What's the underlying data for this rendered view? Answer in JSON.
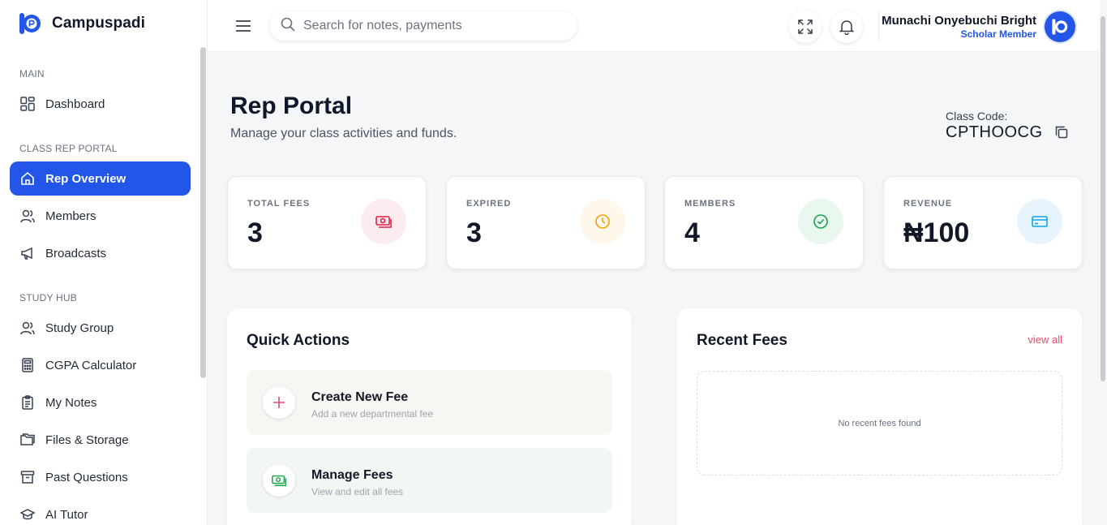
{
  "app": {
    "name": "Campuspadi"
  },
  "sidebar": {
    "sections": [
      {
        "label": "MAIN"
      },
      {
        "label": "CLASS REP PORTAL"
      },
      {
        "label": "STUDY HUB"
      }
    ],
    "items": [
      {
        "label": "Dashboard",
        "icon": "grid-icon"
      },
      {
        "label": "Rep Overview",
        "icon": "home-icon",
        "active": true
      },
      {
        "label": "Members",
        "icon": "users-icon"
      },
      {
        "label": "Broadcasts",
        "icon": "megaphone-icon"
      },
      {
        "label": "Study Group",
        "icon": "users-icon"
      },
      {
        "label": "CGPA Calculator",
        "icon": "calculator-icon"
      },
      {
        "label": "My Notes",
        "icon": "notes-icon"
      },
      {
        "label": "Files & Storage",
        "icon": "folder-icon"
      },
      {
        "label": "Past Questions",
        "icon": "archive-icon"
      },
      {
        "label": "AI Tutor",
        "icon": "graduation-cap-icon"
      }
    ]
  },
  "topbar": {
    "search_placeholder": "Search for notes, payments",
    "user": {
      "name": "Munachi Onyebuchi Bright",
      "role": "Scholar Member"
    }
  },
  "page": {
    "title": "Rep Portal",
    "subtitle": "Manage your class activities and funds.",
    "class_code_label": "Class Code:",
    "class_code": "CPTHOOCG"
  },
  "stats": [
    {
      "label": "TOTAL FEES",
      "value": "3",
      "icon": "cash-icon",
      "color": "#e11d48",
      "bg": "#fdecef"
    },
    {
      "label": "EXPIRED",
      "value": "3",
      "icon": "clock-icon",
      "color": "#f59e0b",
      "bg": "#fef8ea"
    },
    {
      "label": "MEMBERS",
      "value": "4",
      "icon": "check-circle-icon",
      "color": "#16a34a",
      "bg": "#eaf7ee"
    },
    {
      "label": "REVENUE",
      "value": "₦100",
      "icon": "credit-card-icon",
      "color": "#0ea5e9",
      "bg": "#e8f4fd"
    }
  ],
  "quick_actions": {
    "title": "Quick Actions",
    "items": [
      {
        "title": "Create New Fee",
        "subtitle": "Add a new departmental fee",
        "icon": "plus-icon",
        "bg": "#f7f6f2"
      },
      {
        "title": "Manage Fees",
        "subtitle": "View and edit all fees",
        "icon": "cash-icon",
        "bg": "#f3f7f4"
      }
    ]
  },
  "recent_fees": {
    "title": "Recent Fees",
    "view_all": "view all",
    "empty_text": "No recent fees found"
  },
  "colors": {
    "accent": "#2356e8",
    "link": "#e84a6d"
  }
}
